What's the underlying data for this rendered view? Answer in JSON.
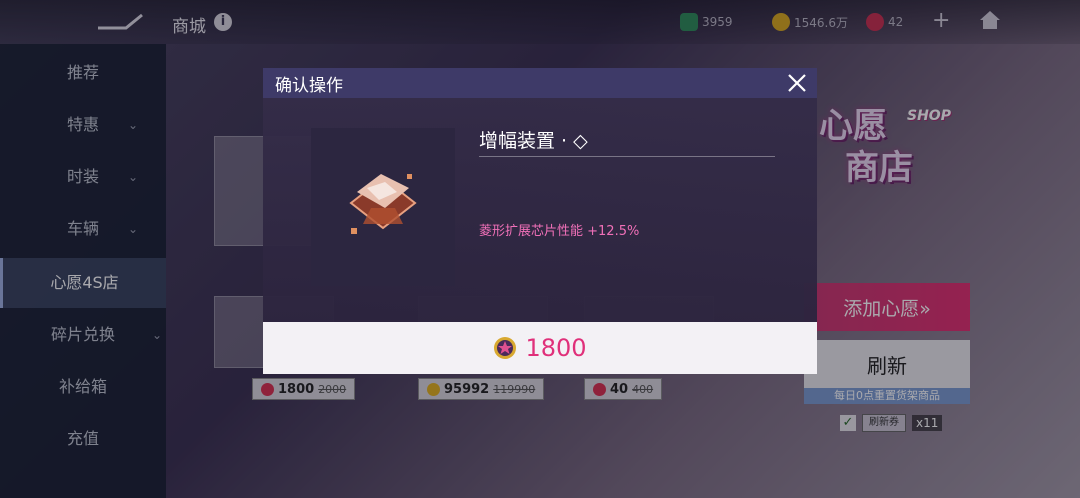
{
  "topbar": {
    "title": "商城",
    "info_glyph": "i",
    "currencies": [
      {
        "icon": "ticket-icon",
        "value": "3959"
      },
      {
        "icon": "star-coin-icon",
        "value": "1546.6万"
      },
      {
        "icon": "wish-coin-icon",
        "value": "42"
      }
    ],
    "plus_glyph": "+"
  },
  "sidebar": {
    "items": [
      {
        "label": "推荐",
        "chevron": ""
      },
      {
        "label": "特惠",
        "chevron": "⌄"
      },
      {
        "label": "时装",
        "chevron": "⌄"
      },
      {
        "label": "车辆",
        "chevron": "⌄"
      },
      {
        "label": "心愿4S店",
        "chevron": ""
      },
      {
        "label": "碎片兑换",
        "chevron": "⌄"
      },
      {
        "label": "补给箱",
        "chevron": ""
      },
      {
        "label": "充值",
        "chevron": ""
      }
    ]
  },
  "shop_items": [
    {
      "price": "1800",
      "old_price": "2000",
      "currency": "wish"
    },
    {
      "price": "95992",
      "old_price": "119990",
      "currency": "star"
    },
    {
      "price": "40",
      "old_price": "400",
      "currency": "wish"
    }
  ],
  "right_panel": {
    "wish_logo_top": "心愿",
    "wish_logo_bottom": "商店",
    "wish_logo_shop": "SHOP",
    "add_wish_label": "添加心愿»",
    "refresh_label": "刷新",
    "refresh_note": "每日0点重置货架商品",
    "checkbox_mark": "✓",
    "ticket_label": "刷新券",
    "ticket_qty": "x11"
  },
  "modal": {
    "title": "确认操作",
    "item_name": "增幅装置 · ◇",
    "item_desc": "菱形扩展芯片性能 +12.5%",
    "confirm_price": "1800"
  },
  "colors": {
    "accent_pink": "#e0307a",
    "desc_pink": "#f070b8",
    "modal_header": "#3e3a68"
  }
}
